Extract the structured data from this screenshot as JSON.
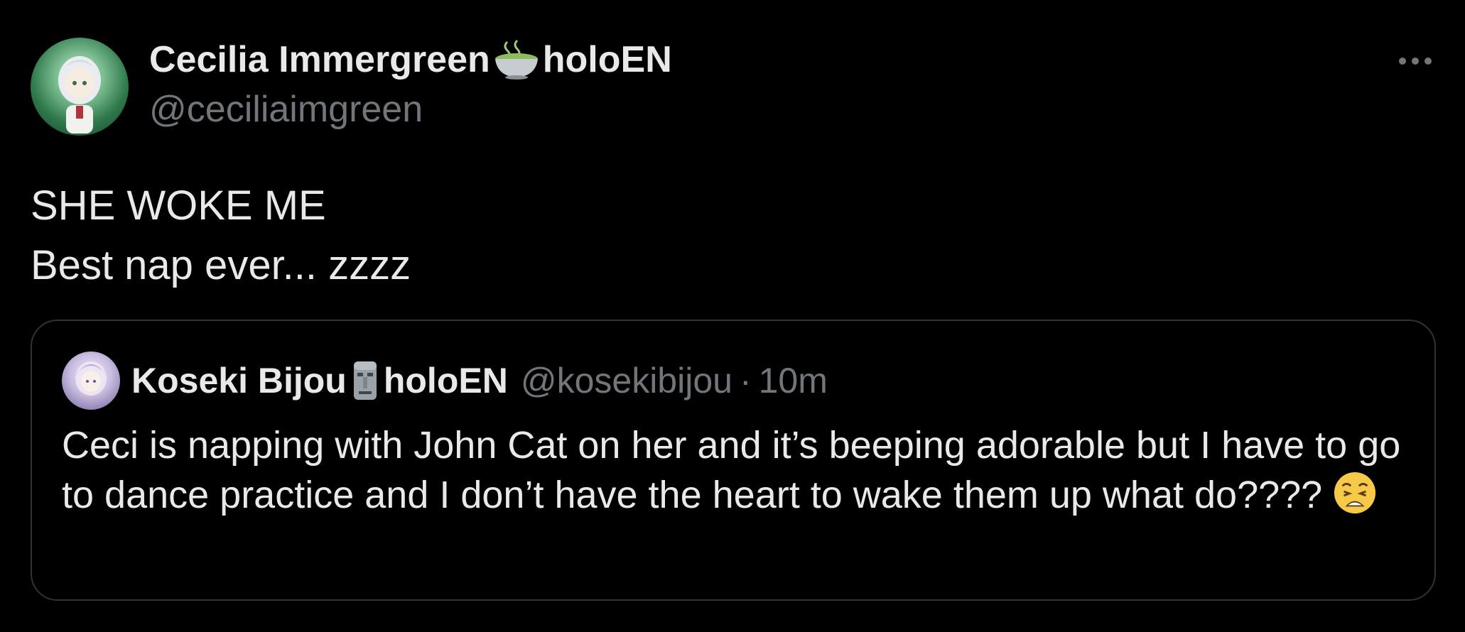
{
  "tweet": {
    "author": {
      "name_part1": "Cecilia Immergreen",
      "name_emoji": "matcha-bowl-icon",
      "name_part2": "holoEN",
      "handle": "@ceciliaimgreen"
    },
    "text_lines": [
      "SHE WOKE ME",
      "Best nap ever... zzzz"
    ],
    "more_icon": "more-horizontal-icon"
  },
  "quote": {
    "author": {
      "name_part1": "Koseki Bijou",
      "name_emoji": "moai-icon",
      "name_part2": "holoEN",
      "handle": "@kosekibijou",
      "separator": "·",
      "time": "10m"
    },
    "text": "Ceci is napping with John Cat on her and it’s beeping adorable but I have to go to dance practice and I don’t have the heart to wake them up what do????",
    "trailing_emoji": "weary-face-icon"
  },
  "colors": {
    "background": "#000000",
    "primary_text": "#e7e9ea",
    "secondary_text": "#71767b",
    "border": "#2f3336"
  }
}
